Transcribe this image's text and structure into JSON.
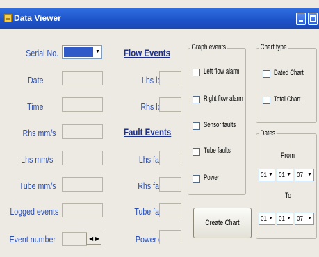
{
  "window": {
    "title": "Data Viewer"
  },
  "serial": {
    "label": "Serial No.",
    "value": ""
  },
  "fields": [
    {
      "label": "Date"
    },
    {
      "label": "Time"
    },
    {
      "label": "Rhs mm/s"
    },
    {
      "label": "Lhs mm/s"
    },
    {
      "label": "Tube mm/s"
    },
    {
      "label": "Logged events"
    },
    {
      "label": "Event number"
    }
  ],
  "flow_events": {
    "header": "Flow Events",
    "items": [
      {
        "label": "Lhs low"
      },
      {
        "label": "Rhs low"
      }
    ]
  },
  "fault_events": {
    "header": "Fault Events",
    "items": [
      {
        "label": "Lhs fault"
      },
      {
        "label": "Rhs fault"
      },
      {
        "label": "Tube fault"
      },
      {
        "label": "Power off"
      }
    ]
  },
  "graph_events": {
    "title": "Graph events",
    "options": [
      {
        "label": "Left flow alarm",
        "checked": false
      },
      {
        "label": "Right flow alarm",
        "checked": false
      },
      {
        "label": "Sensor faults",
        "checked": false
      },
      {
        "label": "Tube faults",
        "checked": false
      },
      {
        "label": "Power",
        "checked": false
      }
    ]
  },
  "chart_type": {
    "title": "Chart type",
    "options": [
      {
        "label": "Dated Chart",
        "checked": false
      },
      {
        "label": "Total Chart",
        "checked": false
      }
    ]
  },
  "create_chart": {
    "label": "Create Chart"
  },
  "dates": {
    "title": "Dates",
    "from_label": "From",
    "to_label": "To",
    "from": [
      "01",
      "01",
      "07"
    ],
    "to": [
      "01",
      "01",
      "07"
    ]
  },
  "colors": {
    "title_bar": "#1d52c8",
    "label_text": "#2a4fb4",
    "window_bg": "#eceae3"
  }
}
